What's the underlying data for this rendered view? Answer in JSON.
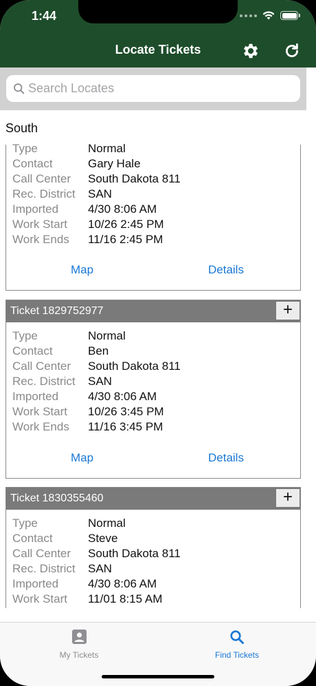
{
  "status_bar": {
    "time": "1:44"
  },
  "nav": {
    "title": "Locate Tickets",
    "settings_icon": "gear-icon",
    "refresh_icon": "refresh-icon"
  },
  "search": {
    "placeholder": "Search Locates",
    "value": ""
  },
  "section": {
    "title": "South"
  },
  "tickets": [
    {
      "rows": [
        {
          "label": "Type",
          "value": "Normal"
        },
        {
          "label": "Contact",
          "value": "Gary Hale"
        },
        {
          "label": "Call Center",
          "value": "South Dakota 811"
        },
        {
          "label": "Rec. District",
          "value": "SAN"
        },
        {
          "label": "Imported",
          "value": "4/30 8:06 AM"
        },
        {
          "label": "Work Start",
          "value": "10/26 2:45 PM"
        },
        {
          "label": "Work Ends",
          "value": "11/16 2:45 PM"
        }
      ],
      "map_label": "Map",
      "details_label": "Details"
    },
    {
      "title": "Ticket 1829752977",
      "expand_label": "+",
      "rows": [
        {
          "label": "Type",
          "value": "Normal"
        },
        {
          "label": "Contact",
          "value": "Ben"
        },
        {
          "label": "Call Center",
          "value": "South Dakota 811"
        },
        {
          "label": "Rec. District",
          "value": "SAN"
        },
        {
          "label": "Imported",
          "value": "4/30 8:06 AM"
        },
        {
          "label": "Work Start",
          "value": "10/26 3:45 PM"
        },
        {
          "label": "Work Ends",
          "value": "11/16 3:45 PM"
        }
      ],
      "map_label": "Map",
      "details_label": "Details"
    },
    {
      "title": "Ticket 1830355460",
      "expand_label": "+",
      "rows": [
        {
          "label": "Type",
          "value": "Normal"
        },
        {
          "label": "Contact",
          "value": "Steve"
        },
        {
          "label": "Call Center",
          "value": "South Dakota 811"
        },
        {
          "label": "Rec. District",
          "value": "SAN"
        },
        {
          "label": "Imported",
          "value": "4/30 8:06 AM"
        },
        {
          "label": "Work Start",
          "value": "11/01 8:15 AM"
        }
      ]
    }
  ],
  "tabbar": {
    "tabs": [
      {
        "label": "My Tickets",
        "icon": "person-icon",
        "selected": false
      },
      {
        "label": "Find Tickets",
        "icon": "search-icon",
        "selected": true
      }
    ]
  },
  "colors": {
    "header": "#1e4d2b",
    "link": "#1a78d4",
    "ticket_header": "#7a7a7a"
  }
}
